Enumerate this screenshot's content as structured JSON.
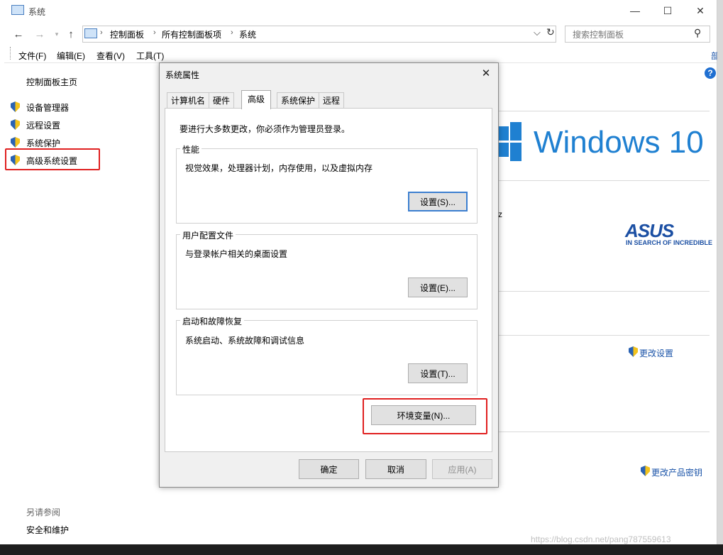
{
  "window": {
    "title": "系统",
    "controls": {
      "minimize": "—",
      "maximize": "☐",
      "close": "✕"
    }
  },
  "nav": {
    "back": "←",
    "forward": "→",
    "up": "↑",
    "breadcrumbs": [
      "控制面板",
      "所有控制面板项",
      "系统"
    ],
    "dropdown": "⌵",
    "refresh": "↻",
    "search_placeholder": "搜索控制面板",
    "search_icon": "⚲"
  },
  "menu": [
    "文件(F)",
    "编辑(E)",
    "查看(V)",
    "工具(T)"
  ],
  "sidebar": {
    "home": "控制面板主页",
    "items": [
      {
        "label": "设备管理器",
        "icon": "shield-icon"
      },
      {
        "label": "远程设置",
        "icon": "shield-icon"
      },
      {
        "label": "系统保护",
        "icon": "shield-icon"
      },
      {
        "label": "高级系统设置",
        "icon": "shield-icon",
        "highlighted": true
      }
    ],
    "see_also_title": "另请参阅",
    "see_also_items": [
      "安全和维护"
    ]
  },
  "background": {
    "windows_logo_text": "Windows 10",
    "asus_logo": "ASUS",
    "asus_tagline": "IN SEARCH OF INCREDIBLE",
    "partial_text": "z",
    "change_settings": "更改设置",
    "change_product_key": "更改产品密钥",
    "help_icon": "?",
    "partial_link": "部"
  },
  "dialog": {
    "title": "系统属性",
    "close": "✕",
    "tabs": [
      {
        "label": "计算机名",
        "active": false
      },
      {
        "label": "硬件",
        "active": false
      },
      {
        "label": "高级",
        "active": true
      },
      {
        "label": "系统保护",
        "active": false
      },
      {
        "label": "远程",
        "active": false
      }
    ],
    "admin_note": "要进行大多数更改，你必须作为管理员登录。",
    "groups": [
      {
        "title": "性能",
        "description": "视觉效果，处理器计划，内存使用，以及虚拟内存",
        "button": "设置(S)..."
      },
      {
        "title": "用户配置文件",
        "description": "与登录帐户相关的桌面设置",
        "button": "设置(E)..."
      },
      {
        "title": "启动和故障恢复",
        "description": "系统启动、系统故障和调试信息",
        "button": "设置(T)..."
      }
    ],
    "env_button": "环境变量(N)...",
    "ok": "确定",
    "cancel": "取消",
    "apply": "应用(A)"
  },
  "watermark": "https://blog.csdn.net/pang787559613",
  "colors": {
    "accent_blue": "#1f80d1",
    "highlight_red": "#e02020",
    "link_blue": "#1a53a8",
    "asus_blue": "#1b4fa3"
  }
}
